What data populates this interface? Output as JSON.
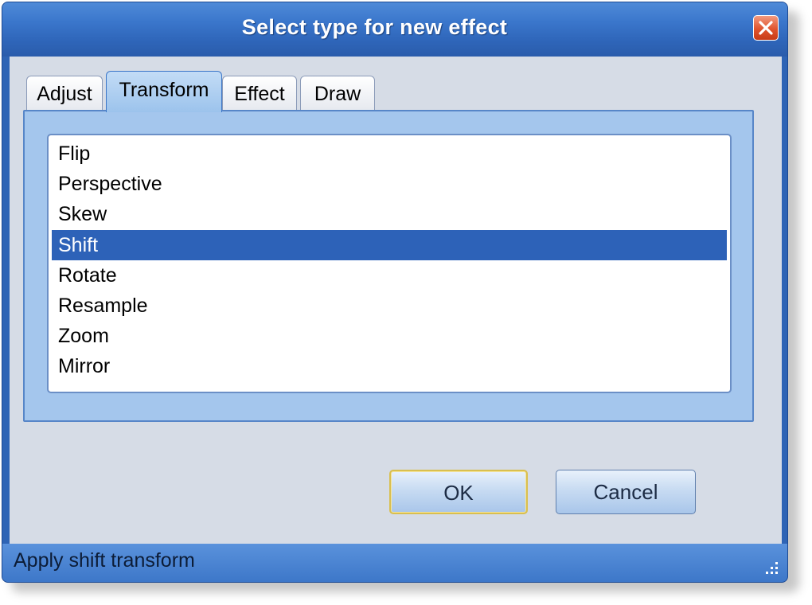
{
  "window": {
    "title": "Select type for new effect",
    "close_icon": "close-icon"
  },
  "tabs": [
    {
      "label": "Adjust"
    },
    {
      "label": "Transform",
      "active": true
    },
    {
      "label": "Effect"
    },
    {
      "label": "Draw"
    }
  ],
  "list": {
    "items": [
      "Flip",
      "Perspective",
      "Skew",
      "Shift",
      "Rotate",
      "Resample",
      "Zoom",
      "Mirror"
    ],
    "selected": "Shift"
  },
  "buttons": {
    "ok_label": "OK",
    "cancel_label": "Cancel"
  },
  "status": {
    "text": "Apply shift transform",
    "grip_icon": "resize-grip-icon"
  },
  "colors": {
    "titlebar": "#3b77cc",
    "selection": "#2d62b8",
    "panel": "#a4c6ed",
    "close_button": "#e0542e"
  }
}
